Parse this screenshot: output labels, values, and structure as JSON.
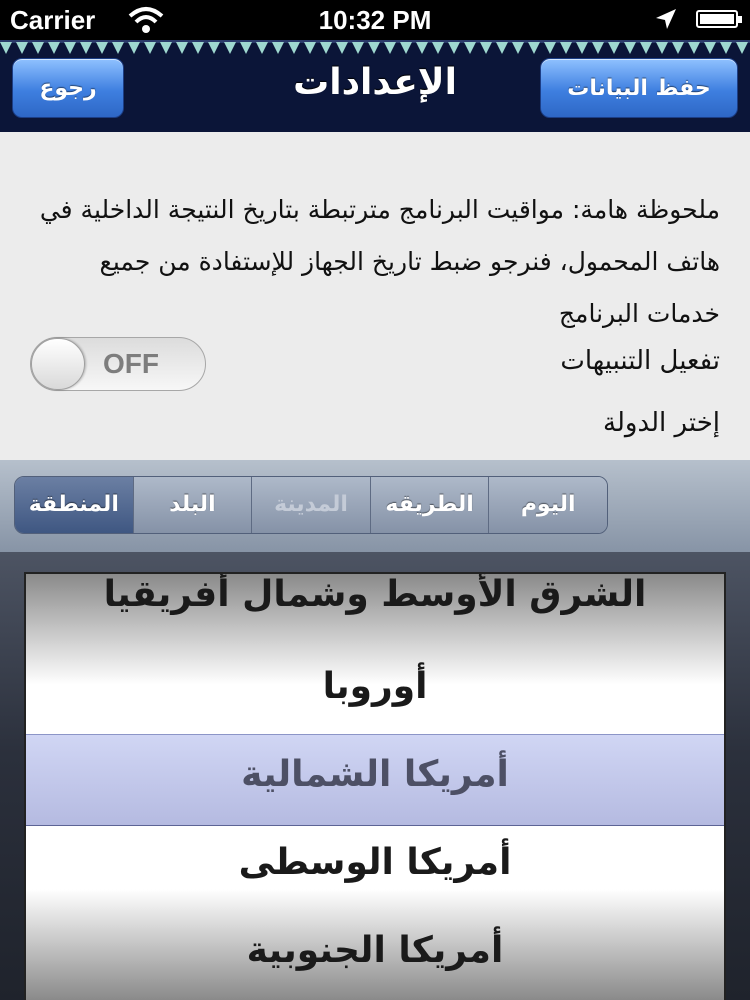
{
  "status_bar": {
    "carrier": "Carrier",
    "time": "10:32 PM",
    "wifi_icon": "wifi-icon",
    "location_icon": "location-arrow-icon",
    "battery_icon": "battery-icon"
  },
  "navbar": {
    "title": "الإعدادات",
    "back_label": "رجوع",
    "save_label": "حفظ البيانات",
    "background": "#0b1538",
    "button_color": "#3e7fe0"
  },
  "settings": {
    "note": "ملحوظة هامة: مواقيت البرنامج مترتبطة بتاريخ النتيجة الداخلية في هاتف المحمول، فنرجو ضبط تاريخ الجهاز للإستفادة من جميع خدمات البرنامج",
    "alerts_label": "تفعيل التنبيهات",
    "alerts_toggle": "OFF",
    "country_label": "إختر الدولة"
  },
  "segments": [
    {
      "label": "اليوم",
      "state": "normal"
    },
    {
      "label": "الطريقه",
      "state": "normal"
    },
    {
      "label": "المدينة",
      "state": "disabled"
    },
    {
      "label": "البلد",
      "state": "normal"
    },
    {
      "label": "المنطقة",
      "state": "selected"
    }
  ],
  "picker": {
    "rows": [
      "الشرق الأوسط وشمال أفريقيا",
      "أوروبا",
      "أمريكا الشمالية",
      "أمريكا الوسطى",
      "أمريكا الجنوبية"
    ],
    "selected_index": 2
  }
}
